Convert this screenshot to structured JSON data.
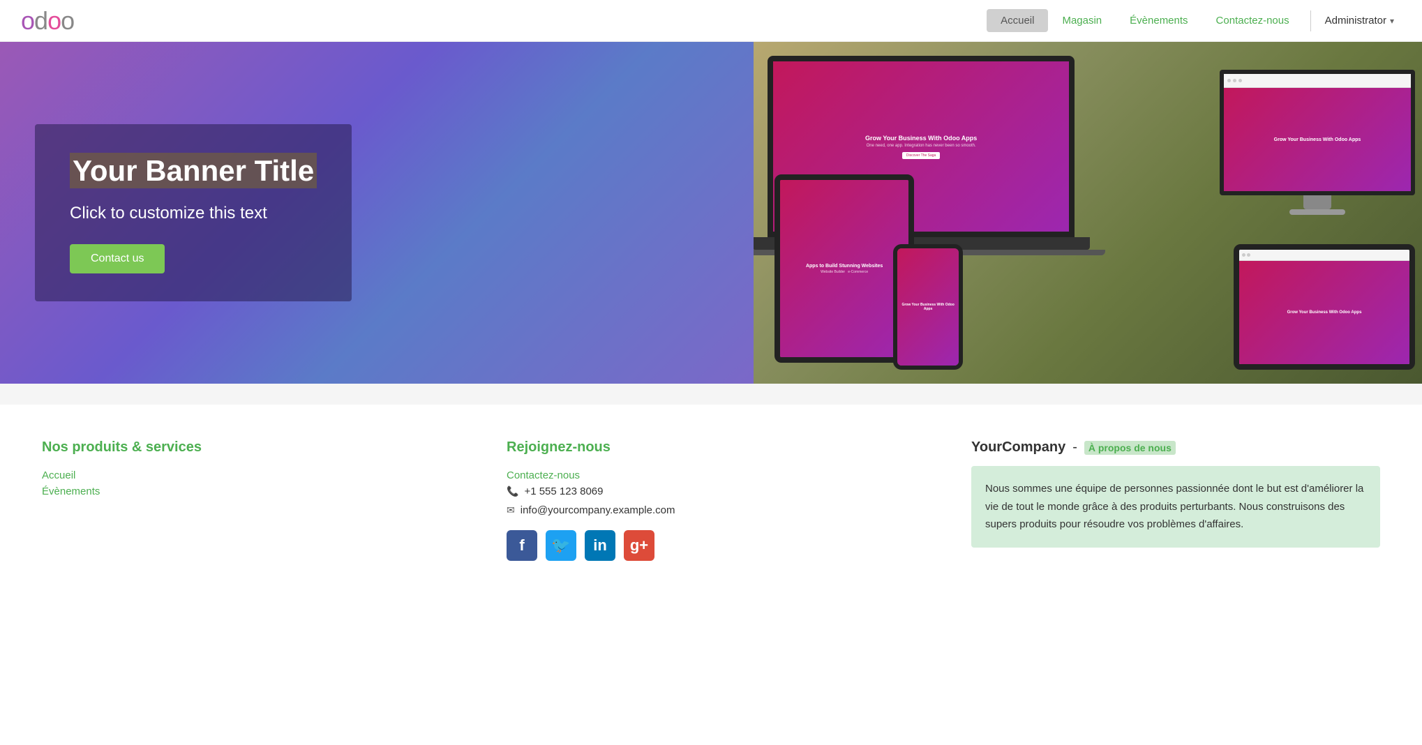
{
  "header": {
    "logo": "odoo",
    "nav": [
      {
        "id": "accueil",
        "label": "Accueil",
        "active": true
      },
      {
        "id": "magasin",
        "label": "Magasin",
        "active": false
      },
      {
        "id": "evenements",
        "label": "Évènements",
        "active": false
      },
      {
        "id": "contactez-nous",
        "label": "Contactez-nous",
        "active": false
      }
    ],
    "admin_label": "Administrator"
  },
  "hero": {
    "banner_title": "Your Banner Title",
    "banner_subtitle": "Click to customize this text",
    "contact_btn": "Contact us"
  },
  "footer": {
    "col1": {
      "title": "Nos produits & services",
      "links": [
        "Accueil",
        "Évènements"
      ]
    },
    "col2": {
      "title": "Rejoignez-nous",
      "contact_link": "Contactez-nous",
      "phone": "+1 555 123 8069",
      "email": "info@yourcompany.example.com",
      "social": [
        {
          "id": "facebook",
          "label": "f"
        },
        {
          "id": "twitter",
          "label": "𝕥"
        },
        {
          "id": "linkedin",
          "label": "in"
        },
        {
          "id": "googleplus",
          "label": "g+"
        }
      ]
    },
    "col3": {
      "company_name": "YourCompany",
      "dash": "-",
      "about_link": "À propos de nous",
      "description": "Nous sommes une équipe de personnes passionnée dont le but est d'améliorer la vie de tout le monde grâce à des produits perturbants. Nous construisons des supers produits pour résoudre vos problèmes d'affaires."
    }
  },
  "devices": {
    "laptop_title": "Grow Your Business With Odoo Apps",
    "laptop_sub": "One need, one app. Integration has never been so smooth.",
    "monitor_title": "Grow Your Business With Odoo Apps",
    "phone_title": "Grow Your Business With Odoo Apps",
    "tablet_title": "Apps to Build Stunning Websites",
    "tablet_h_title": "Grow Your Business With Odoo Apps"
  }
}
